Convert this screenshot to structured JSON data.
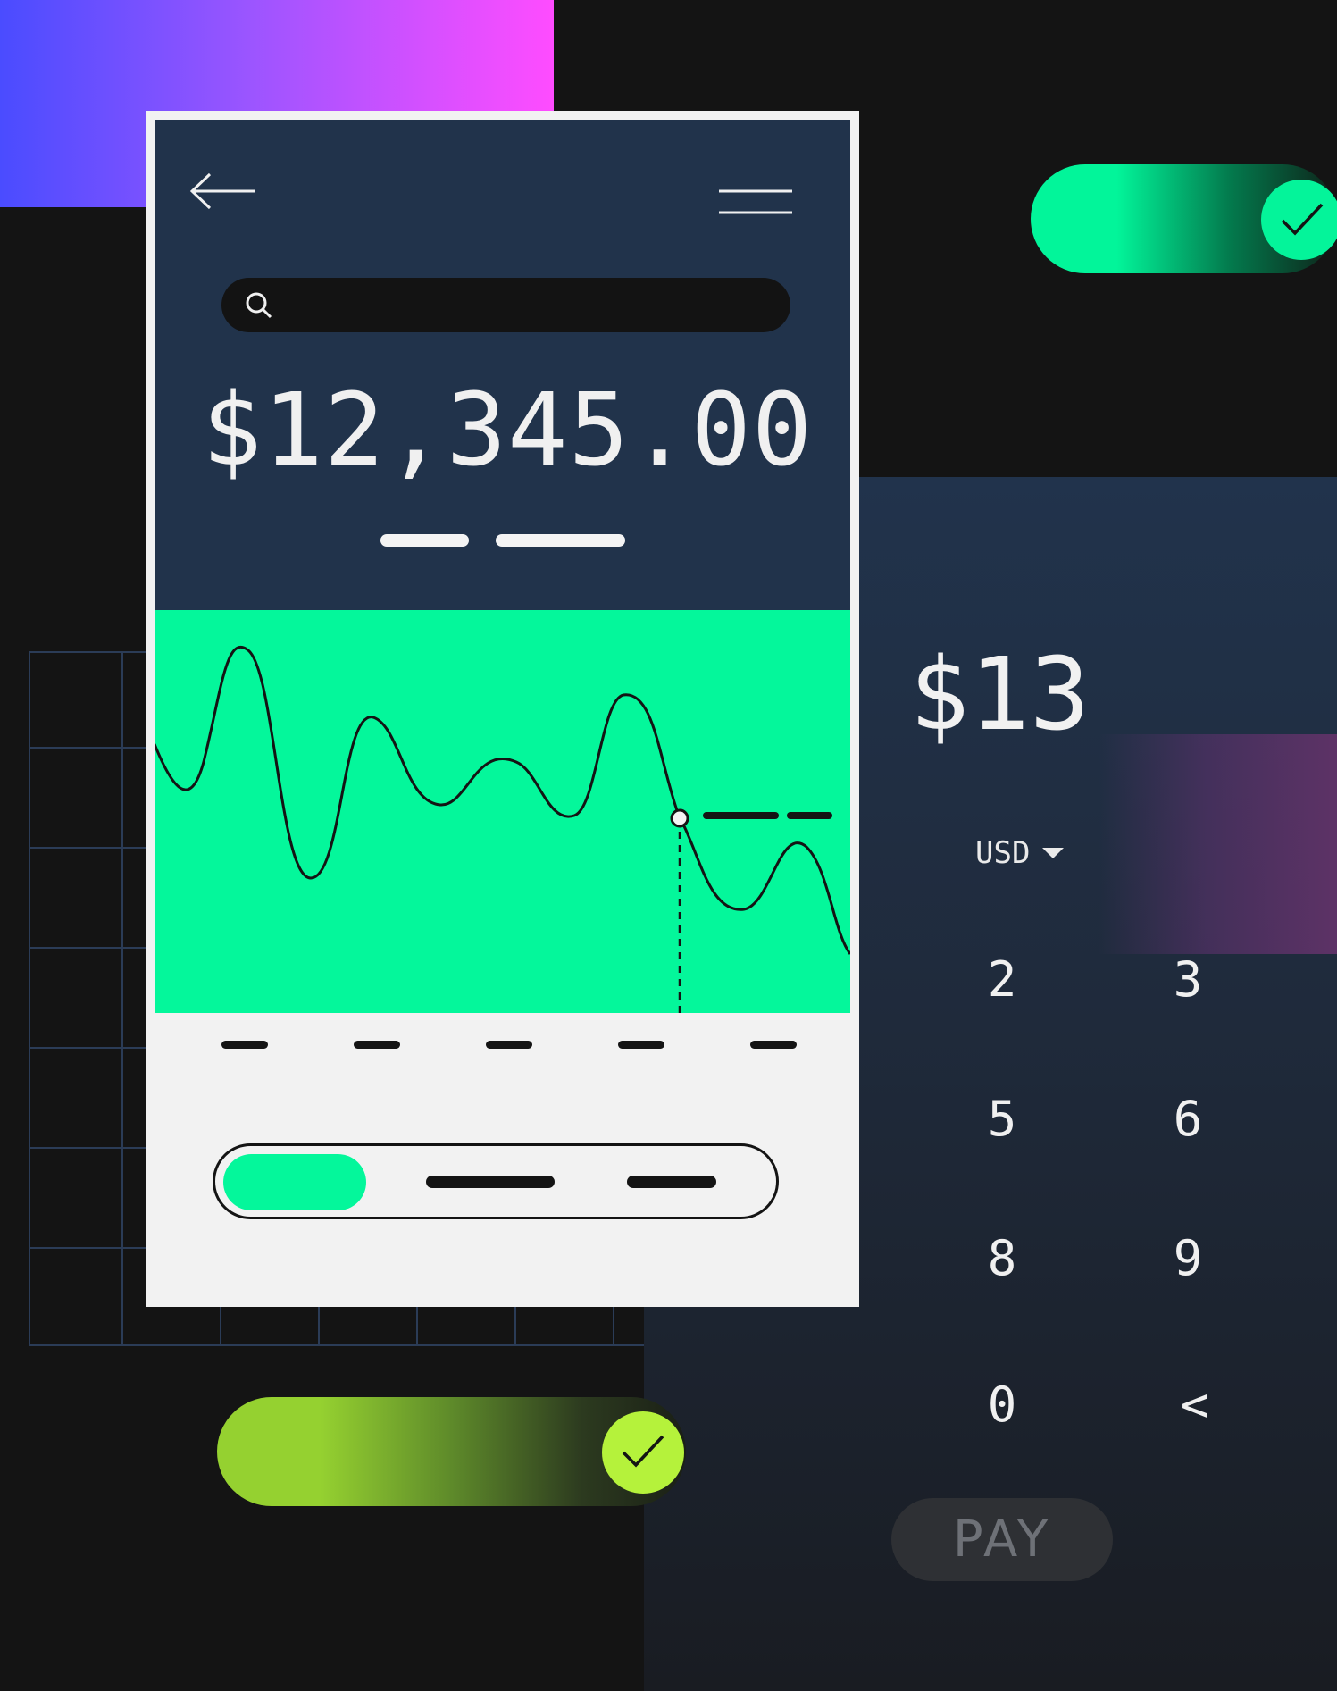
{
  "balance": "$12,345.00",
  "keypad": {
    "amount": "$13",
    "currency": "USD",
    "keys": [
      "2",
      "3",
      "5",
      "6",
      "8",
      "9",
      "0",
      "<"
    ],
    "pay_label": "PAY"
  },
  "colors": {
    "accent_green": "#04f79b",
    "lime": "#b5f23b",
    "header_navy": "#21334b",
    "gradient_start": "#4a4cff",
    "gradient_end": "#ff4cff"
  },
  "icons": [
    "back-arrow-icon",
    "menu-icon",
    "search-icon",
    "check-icon",
    "chevron-down-icon"
  ]
}
